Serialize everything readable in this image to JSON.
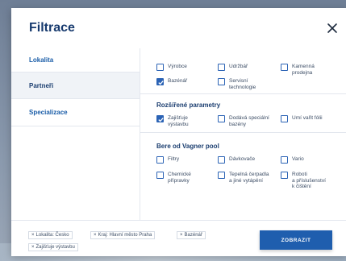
{
  "modal": {
    "title": "Filtrace",
    "close_icon": "close-icon"
  },
  "sidebar": {
    "items": [
      {
        "label": "Lokalita",
        "active": false
      },
      {
        "label": "Partneři",
        "active": true
      },
      {
        "label": "Specializace",
        "active": false
      }
    ]
  },
  "partners": {
    "options": [
      {
        "label": "Výrobce",
        "checked": false
      },
      {
        "label": "Udržbář",
        "checked": false
      },
      {
        "label": "Kamenná\nprodejna",
        "checked": false
      },
      {
        "label": "Bazénář",
        "checked": true
      },
      {
        "label": "Servisní\ntechnologie",
        "checked": false
      }
    ]
  },
  "extended": {
    "title": "Rozšířené parametry",
    "options": [
      {
        "label": "Zajišťuje\nvýstavbu",
        "checked": true
      },
      {
        "label": "Dodává speciální\nbazény",
        "checked": false
      },
      {
        "label": "Umí vařit fólii",
        "checked": false
      }
    ]
  },
  "vagner": {
    "title": "Bere od Vagner pool",
    "options": [
      {
        "label": "Filtry",
        "checked": false
      },
      {
        "label": "Dávkovače",
        "checked": false
      },
      {
        "label": "Vario",
        "checked": false
      },
      {
        "label": "Chemické\npřípravky",
        "checked": false
      },
      {
        "label": "Tepelná čerpadla\na jiné vytápění",
        "checked": false
      },
      {
        "label": "Roboti\na příslušenství\nk čištění",
        "checked": false
      }
    ]
  },
  "footer": {
    "chips": [
      "Lokalita: Česko",
      "Kraj: Hlavní město Praha",
      "Bazénář",
      "Zajišťuje výstavbu"
    ],
    "chip_prefix": "×",
    "show_button": "ZOBRAZIT"
  },
  "colors": {
    "accent": "#1f5eae",
    "title": "#173a6e",
    "link": "#1a5da8"
  }
}
